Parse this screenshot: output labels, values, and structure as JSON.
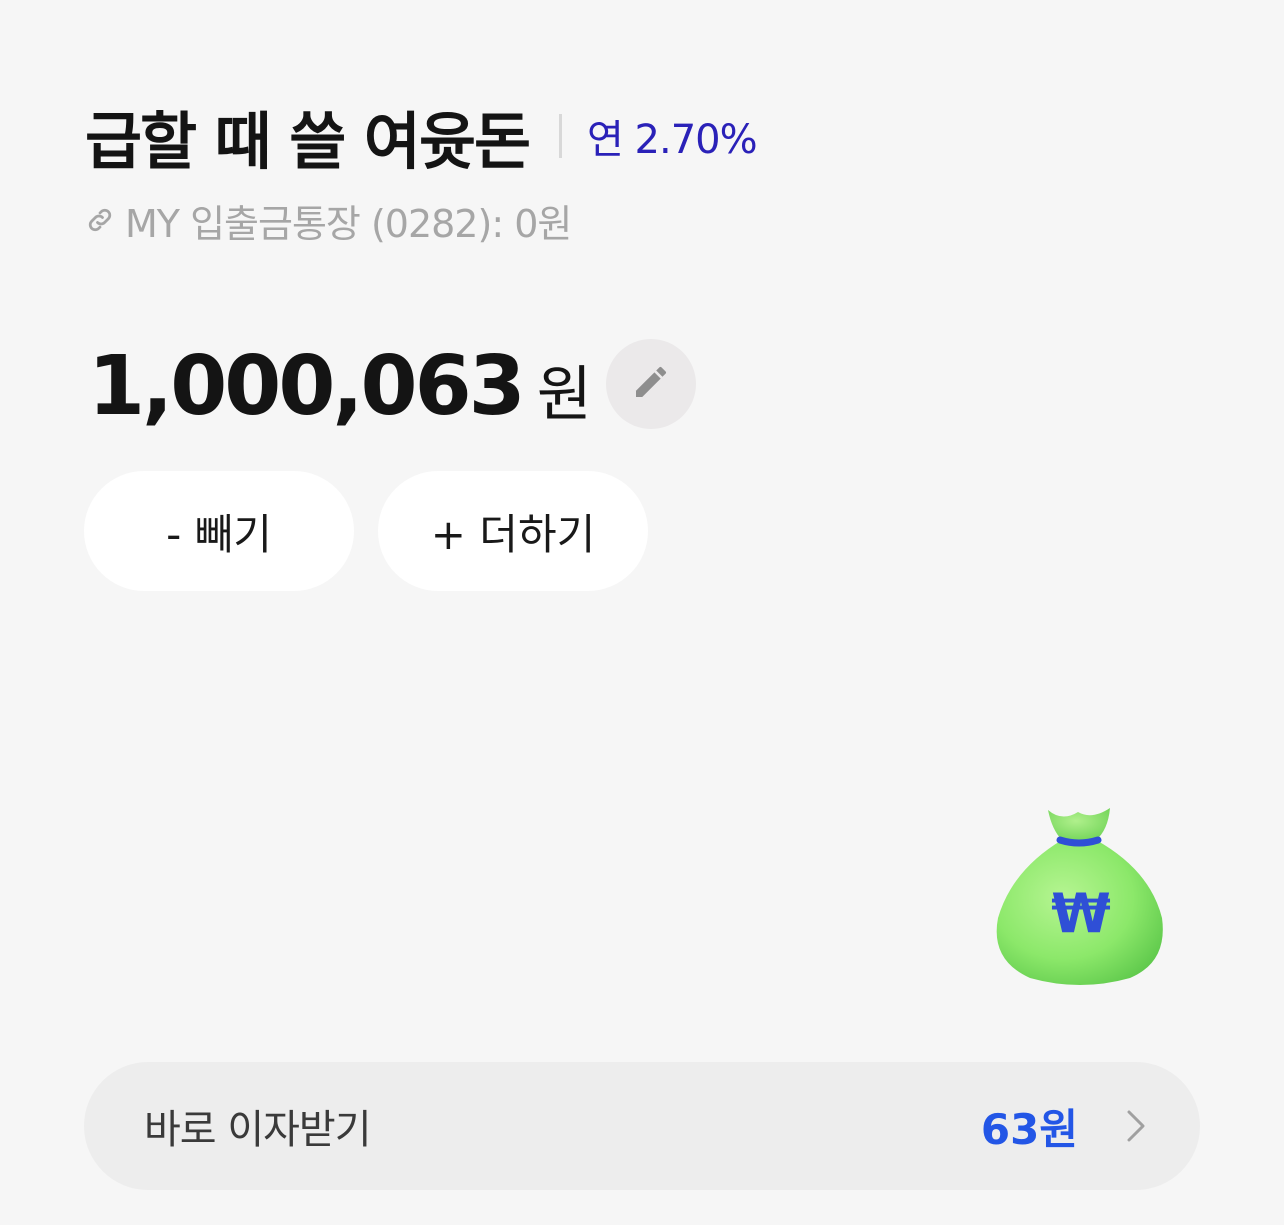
{
  "account": {
    "title": "급할 때 쓸 여윳돈",
    "rate": "연 2.70%",
    "linked_account": "MY 입출금통장 (0282): 0원"
  },
  "balance": {
    "amount": "1,000,063",
    "unit": "원"
  },
  "actions": {
    "withdraw_label": "- 빼기",
    "deposit_label": "+ 더하기"
  },
  "interest": {
    "label": "바로 이자받기",
    "amount": "63원"
  },
  "illustration": {
    "symbol": "₩"
  },
  "icons": {
    "link": "link-icon",
    "edit": "pencil-icon",
    "chevron": "chevron-right-icon",
    "bag": "money-bag-icon"
  },
  "colors": {
    "background": "#f6f6f6",
    "rate": "#2a21b8",
    "interest_amount": "#2356e6",
    "bag_green": "#8ce86a",
    "bag_symbol": "#2f4fd6"
  }
}
